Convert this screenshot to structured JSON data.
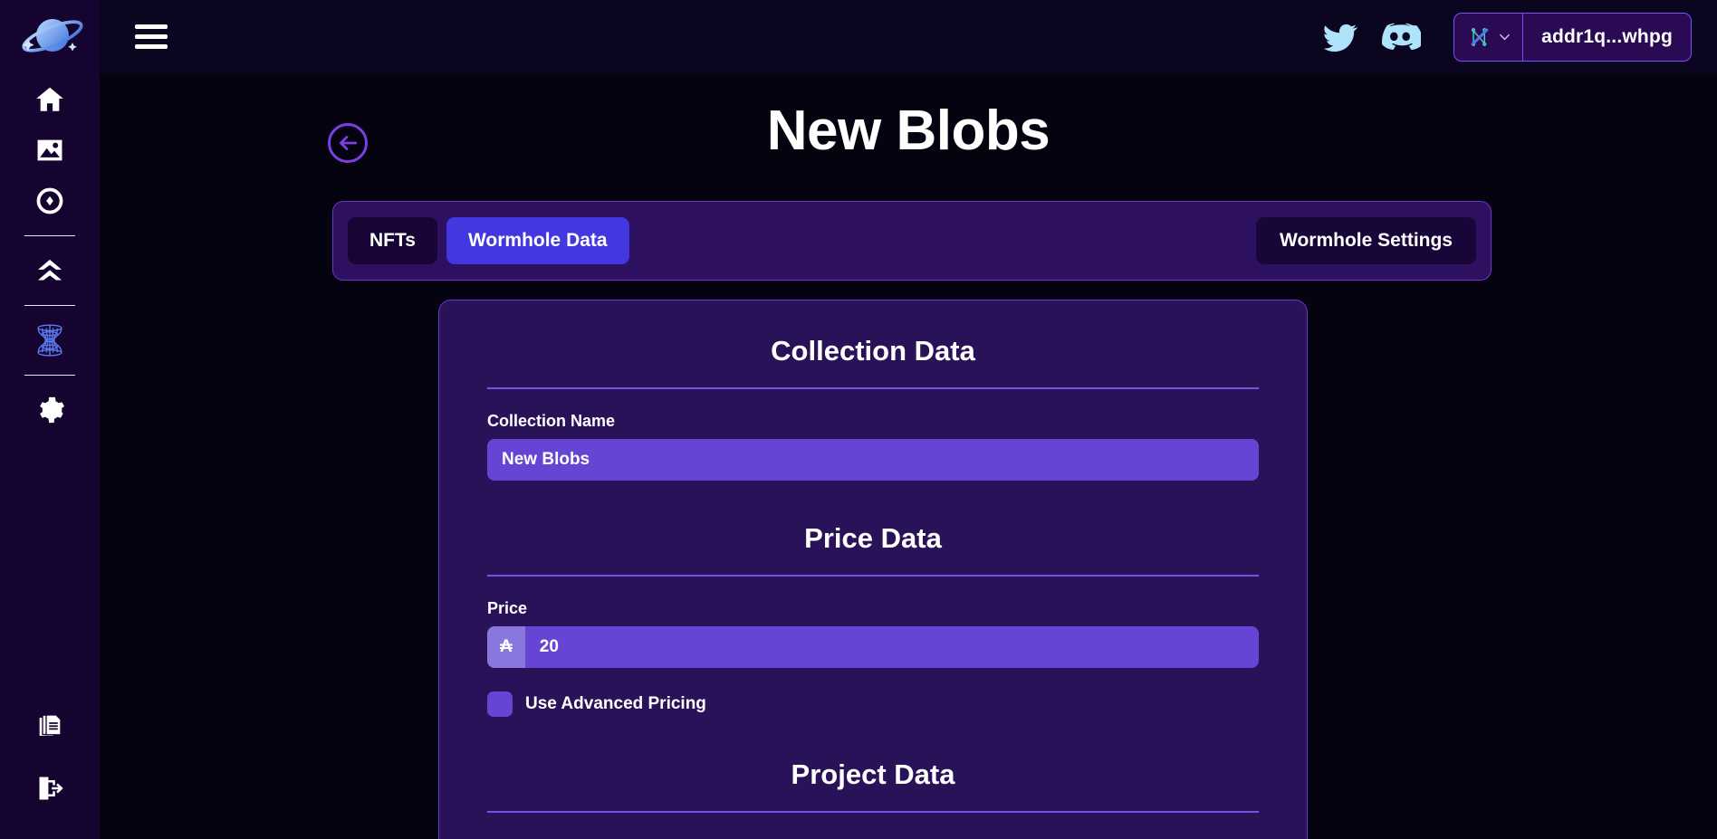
{
  "app": {
    "logo_icon": "planet-logo-icon",
    "background_color": "#05030f",
    "accent_color": "#6645d4",
    "card_color": "#2a1259",
    "active_tab_color": "#4338e0"
  },
  "sidebar": {
    "items": [
      {
        "id": "home",
        "icon": "home-icon",
        "label": "Home"
      },
      {
        "id": "gallery",
        "icon": "image-icon",
        "label": "Gallery"
      },
      {
        "id": "token",
        "icon": "token-icon",
        "label": "Token"
      },
      {
        "id": "mint",
        "icon": "double-chevron-up-icon",
        "label": "Mint"
      },
      {
        "id": "wormhole",
        "icon": "wormhole-icon",
        "label": "Wormhole"
      },
      {
        "id": "settings",
        "icon": "gear-icon",
        "label": "Settings"
      },
      {
        "id": "docs",
        "icon": "documents-icon",
        "label": "Docs"
      },
      {
        "id": "logout",
        "icon": "logout-icon",
        "label": "Log Out"
      }
    ]
  },
  "header": {
    "menu_icon": "hamburger-menu-icon",
    "twitter_icon": "twitter-icon",
    "discord_icon": "discord-icon",
    "wallet": {
      "icon": "nami-wallet-icon",
      "chevron": "chevron-down-icon",
      "address": "addr1q...whpg"
    }
  },
  "main": {
    "back_icon": "arrow-left-icon",
    "title": "New Blobs",
    "tabs": [
      {
        "label": "NFTs",
        "active": false
      },
      {
        "label": "Wormhole Data",
        "active": true
      }
    ],
    "settings_button_label": "Wormhole Settings",
    "sections": [
      {
        "id": "collection-data",
        "title": "Collection Data",
        "fields": [
          {
            "id": "collection-name",
            "label": "Collection Name",
            "value": "New Blobs",
            "placeholder": "Collection Name"
          }
        ]
      },
      {
        "id": "price-data",
        "title": "Price Data",
        "fields": [
          {
            "id": "price",
            "label": "Price",
            "prefix": "₳",
            "value": "20",
            "placeholder": "Price"
          }
        ],
        "checkbox": {
          "id": "use-advanced-pricing",
          "label": "Use Advanced Pricing",
          "checked": false
        }
      },
      {
        "id": "project-data",
        "title": "Project Data"
      }
    ]
  }
}
